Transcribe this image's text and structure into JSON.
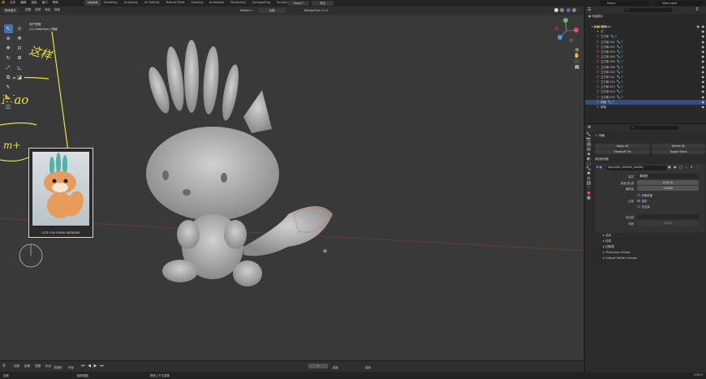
{
  "top_menu": [
    "文件",
    "编辑",
    "渲染",
    "窗口",
    "帮助"
  ],
  "workspace_tabs": [
    {
      "label": "Layout",
      "active": true
    },
    {
      "label": "Modeling"
    },
    {
      "label": "Sculpting"
    },
    {
      "label": "UV Editing"
    },
    {
      "label": "Texture Paint"
    },
    {
      "label": "Shading"
    },
    {
      "label": "Animation"
    },
    {
      "label": "Rendering"
    },
    {
      "label": "Compositing"
    },
    {
      "label": "Scripting"
    }
  ],
  "top_right": {
    "scene_label": "Scene",
    "view_layer_label": "View Layer",
    "import_label": "Import",
    "export_label": "导出"
  },
  "header": {
    "mode": "物体模式",
    "view": "视图",
    "select": "选择",
    "add": "添加",
    "object": "物体",
    "orientation": "全局",
    "modifier_dropdown": "Models ▾",
    "addon": "RetopoFlow 3.1.0"
  },
  "viewport": {
    "overlay_title": "用户透视",
    "overlay_subtitle": "(1) Collection | 网格",
    "handwriting": [
      "这样",
      "Mao",
      "m+"
    ],
    "ref_caption": "CUTE FOX FRESH ARTWORK"
  },
  "outliner": {
    "title": "场景集合",
    "collection": "Collection",
    "items": [
      {
        "label": "摄像",
        "icon": "camera-icon",
        "mod": false,
        "sel": false
      },
      {
        "label": "灯",
        "icon": "light-icon",
        "mod": false,
        "sel": false
      },
      {
        "label": "立方体",
        "icon": "mesh-icon",
        "mod": true,
        "sel": false
      },
      {
        "label": "立方体.001",
        "icon": "mesh-icon",
        "mod": true,
        "sel": false
      },
      {
        "label": "立方体.002",
        "icon": "mesh-icon",
        "mod": true,
        "sel": false
      },
      {
        "label": "立方体.003",
        "icon": "mesh-icon",
        "mod": true,
        "sel": false
      },
      {
        "label": "立方体.004",
        "icon": "mesh-icon",
        "mod": true,
        "sel": false
      },
      {
        "label": "立方体.005",
        "icon": "mesh-icon",
        "mod": true,
        "sel": false
      },
      {
        "label": "立方体.009",
        "icon": "mesh-icon",
        "mod": true,
        "sel": false
      },
      {
        "label": "立方体.010",
        "icon": "mesh-icon",
        "mod": true,
        "sel": false
      },
      {
        "label": "立方体.011",
        "icon": "mesh-icon",
        "mod": true,
        "sel": false
      },
      {
        "label": "立方体.012",
        "icon": "mesh-icon",
        "mod": true,
        "sel": false
      },
      {
        "label": "立方体.013",
        "icon": "mesh-icon",
        "mod": true,
        "sel": false
      },
      {
        "label": "立方体.014",
        "icon": "mesh-icon",
        "mod": true,
        "sel": false
      },
      {
        "label": "立方体.015",
        "icon": "mesh-icon",
        "mod": true,
        "sel": false
      },
      {
        "label": "网格",
        "icon": "mesh-icon",
        "mod": true,
        "sel": true
      },
      {
        "label": "带格",
        "icon": "mesh-icon",
        "mod": false,
        "sel": false
      }
    ]
  },
  "properties": {
    "object_name": "网格",
    "apply_all": "Apply All",
    "delete_all": "Delete All",
    "viewport_vis": "Viewport Vis",
    "toggle_stack": "Toggle Stack",
    "add_modifier": "添加修改器",
    "modifier_name": "geometry_extract_solidify",
    "mode_label": "模式",
    "mode_value": "简单型",
    "thickness_label": "厚度(宽)度",
    "thickness_value": "0.02 m",
    "offset_label": "偏移量",
    "offset_value": "1.0000",
    "even_thickness": "均衡厚度",
    "rim_label": "边缘",
    "fill_label": "填充",
    "only_rim": "仅边缘",
    "vgroup_label": "顶点组",
    "factor_label": "系数",
    "factor_value": "0.000",
    "sections": [
      "法向",
      "材质",
      "边数据",
      "Thickness Clamp",
      "Output Vertex Groups"
    ]
  },
  "timeline": {
    "items": [
      "回放",
      "抠像",
      "视图",
      "标记"
    ],
    "keying_label": "关键帧",
    "auto_label": "开始",
    "frame": "1",
    "start_label": "起始",
    "end_label": "结束"
  },
  "status": {
    "select": "选择",
    "rotate": "旋转视图",
    "menu": "物体上下文菜单",
    "version": "2.92.0"
  }
}
